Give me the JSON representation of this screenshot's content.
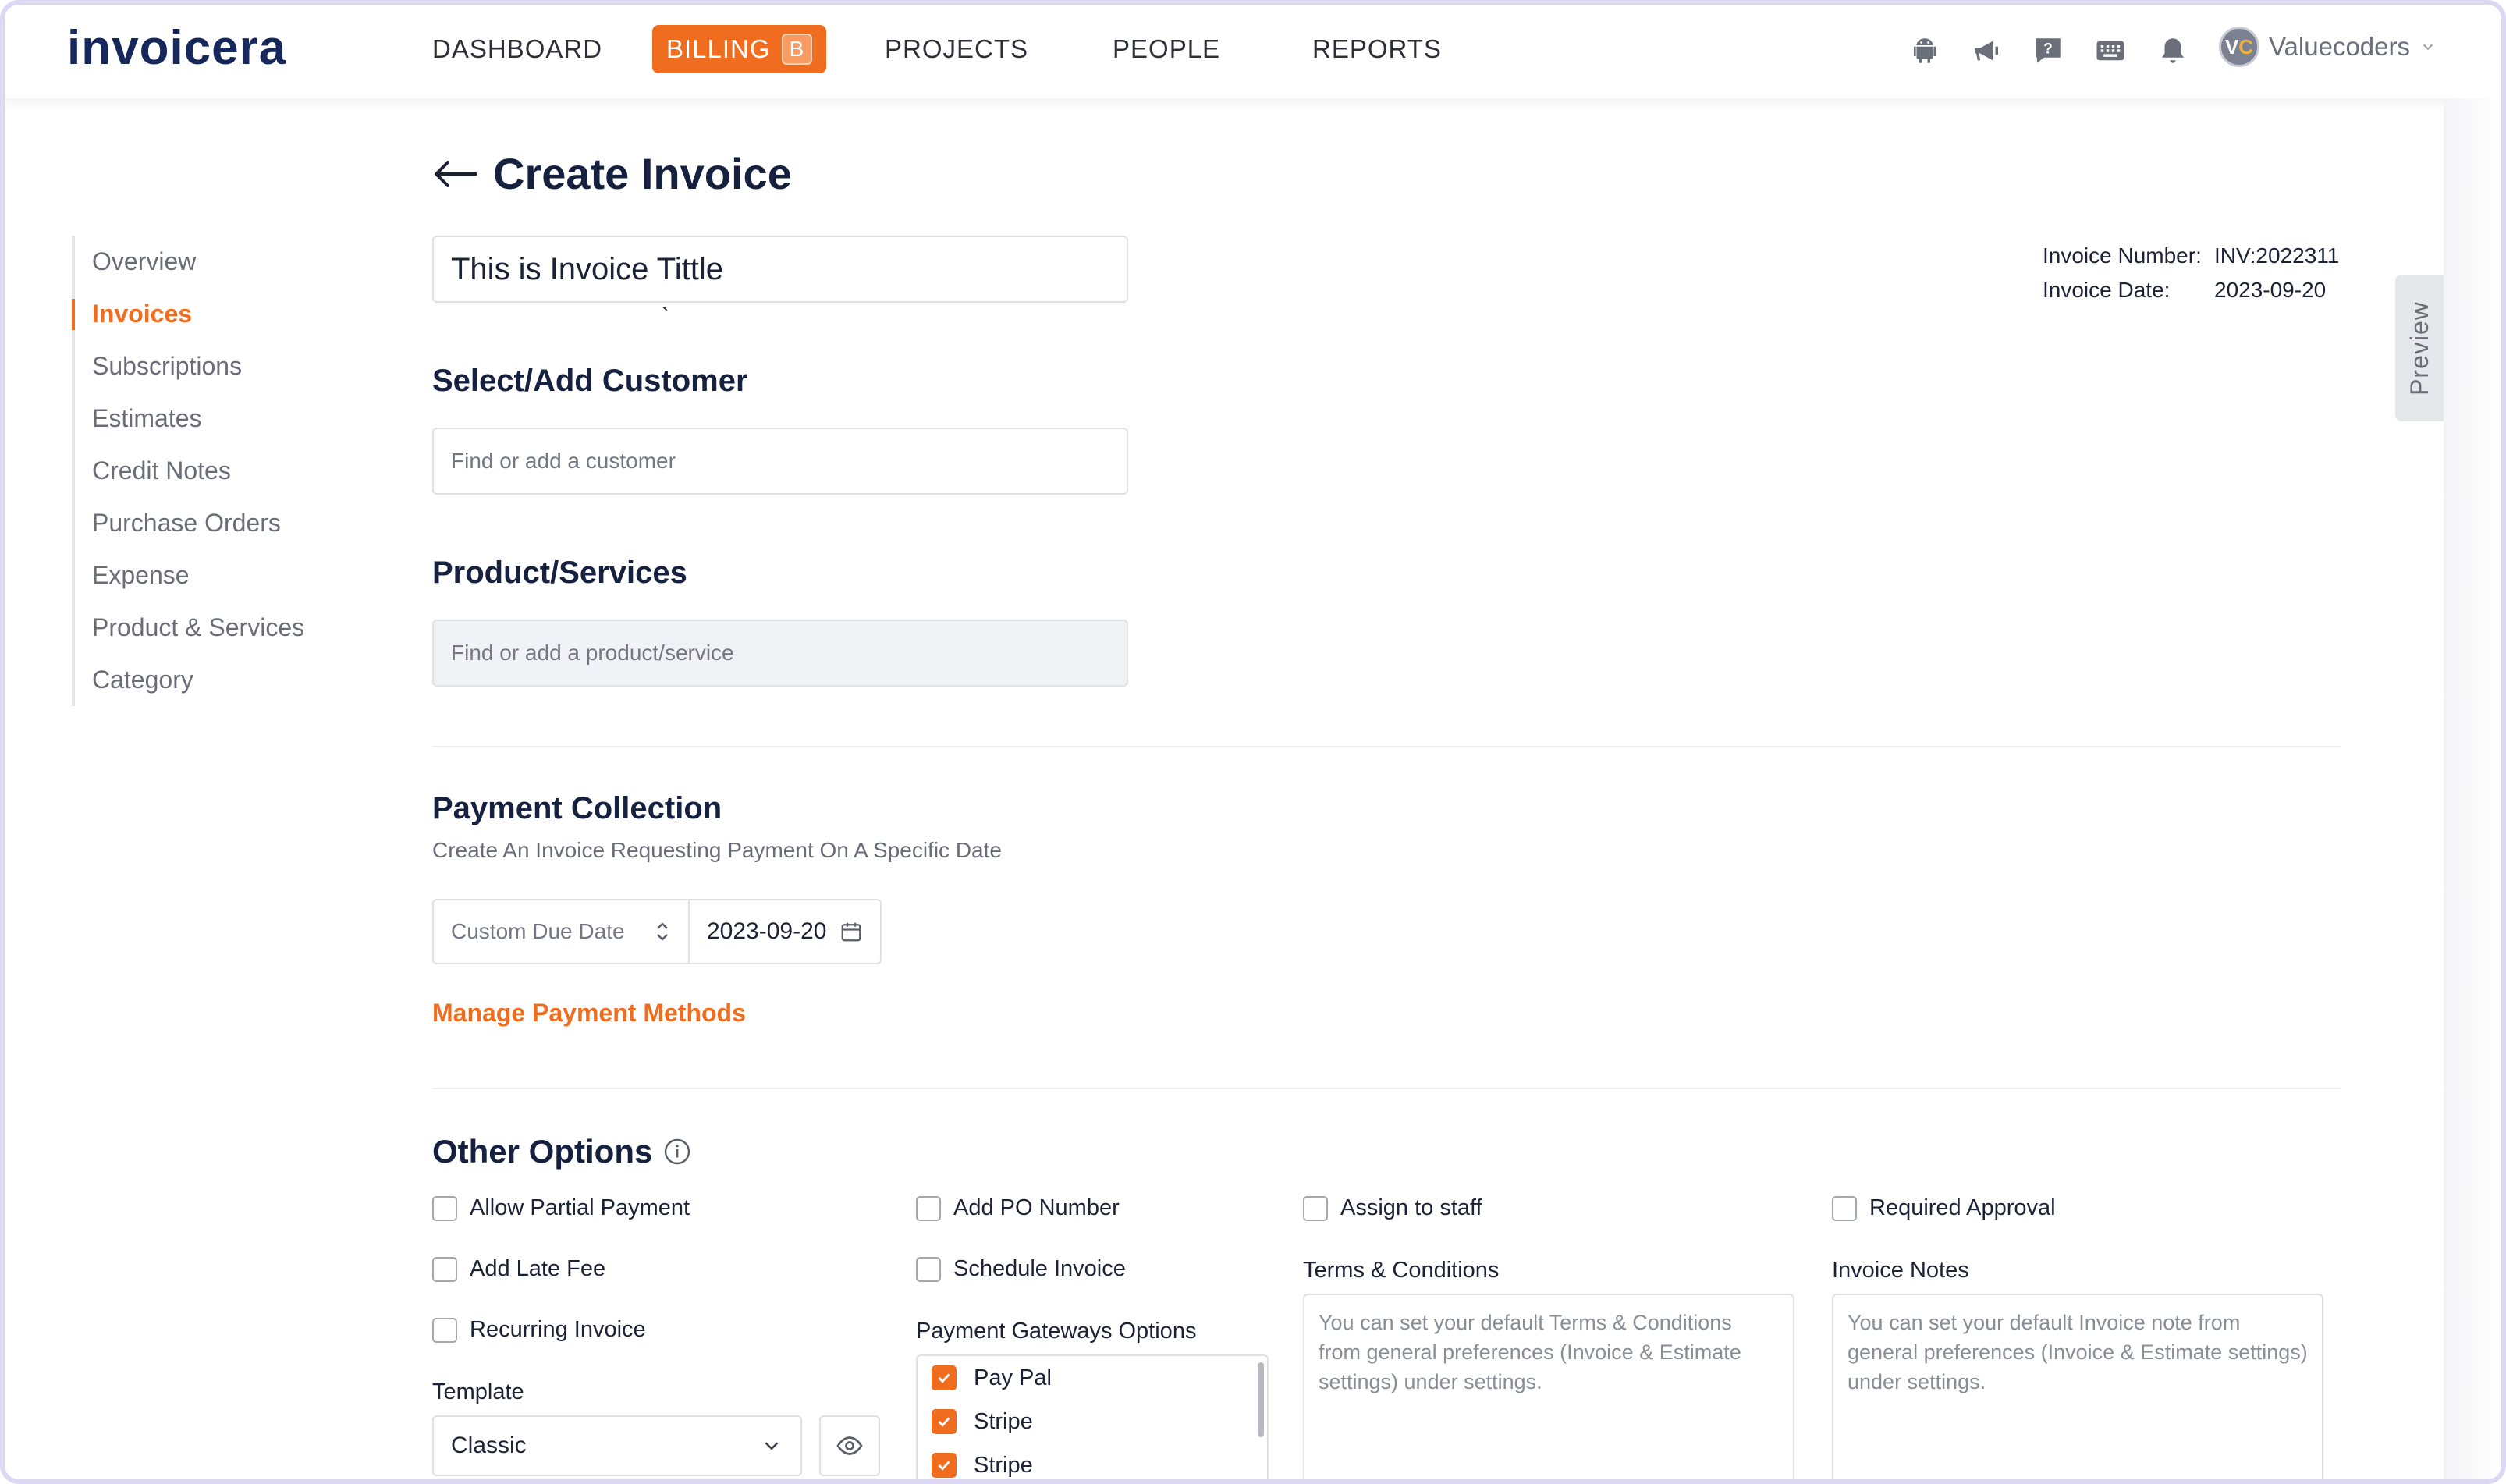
{
  "app": {
    "logo": "invoicera"
  },
  "nav": {
    "items": [
      "DASHBOARD",
      "PROJECTS",
      "PEOPLE",
      "REPORTS"
    ],
    "active": "BILLING",
    "active_badge": "B"
  },
  "account": {
    "initials_v": "V",
    "initials_c": "C",
    "name": "Valuecoders"
  },
  "sidebar": {
    "items": [
      {
        "label": "Overview"
      },
      {
        "label": "Invoices"
      },
      {
        "label": "Subscriptions"
      },
      {
        "label": "Estimates"
      },
      {
        "label": "Credit Notes"
      },
      {
        "label": "Purchase Orders"
      },
      {
        "label": "Expense"
      },
      {
        "label": "Product & Services"
      },
      {
        "label": "Category"
      }
    ],
    "active_index": 1
  },
  "page": {
    "title": "Create Invoice",
    "invoice_title_value": "This is Invoice Tittle",
    "caret_mark": "`"
  },
  "invoice_meta": {
    "number_label": "Invoice Number:",
    "number_value": "INV:2022311",
    "date_label": "Invoice Date:",
    "date_value": "2023-09-20"
  },
  "preview_tab": "Preview",
  "customer": {
    "heading": "Select/Add Customer",
    "placeholder": "Find or add a customer"
  },
  "product": {
    "heading": "Product/Services",
    "placeholder": "Find or add a product/service"
  },
  "payment": {
    "heading": "Payment Collection",
    "subtitle": "Create An Invoice Requesting Payment On A Specific Date",
    "due_type": "Custom Due Date",
    "due_date": "2023-09-20",
    "manage_link": "Manage Payment Methods"
  },
  "other_options": {
    "heading": "Other Options",
    "allow_partial_payment": {
      "label": "Allow Partial Payment",
      "checked": false
    },
    "add_late_fee": {
      "label": "Add Late Fee",
      "checked": false
    },
    "recurring_invoice": {
      "label": "Recurring Invoice",
      "checked": false
    },
    "add_po_number": {
      "label": "Add PO Number",
      "checked": false
    },
    "schedule_invoice": {
      "label": "Schedule Invoice",
      "checked": false
    },
    "assign_to_staff": {
      "label": "Assign to staff",
      "checked": false
    },
    "required_approval": {
      "label": "Required Approval",
      "checked": false
    },
    "template_label": "Template",
    "template_value": "Classic",
    "gateways_label": "Payment Gateways Options",
    "gateways": [
      {
        "label": "Pay Pal",
        "checked": true
      },
      {
        "label": "Stripe",
        "checked": true
      },
      {
        "label": "Stripe",
        "checked": true
      }
    ],
    "terms_label": "Terms & Conditions",
    "terms_placeholder": "You can set your default Terms & Conditions from general preferences (Invoice & Estimate settings) under settings.",
    "notes_label": "Invoice Notes",
    "notes_placeholder": "You can set your default Invoice note from general preferences (Invoice & Estimate settings) under settings."
  },
  "colors": {
    "accent": "#f06d1f",
    "heading": "#16203f",
    "muted": "#6a6d78",
    "border": "#dfe1e6"
  }
}
